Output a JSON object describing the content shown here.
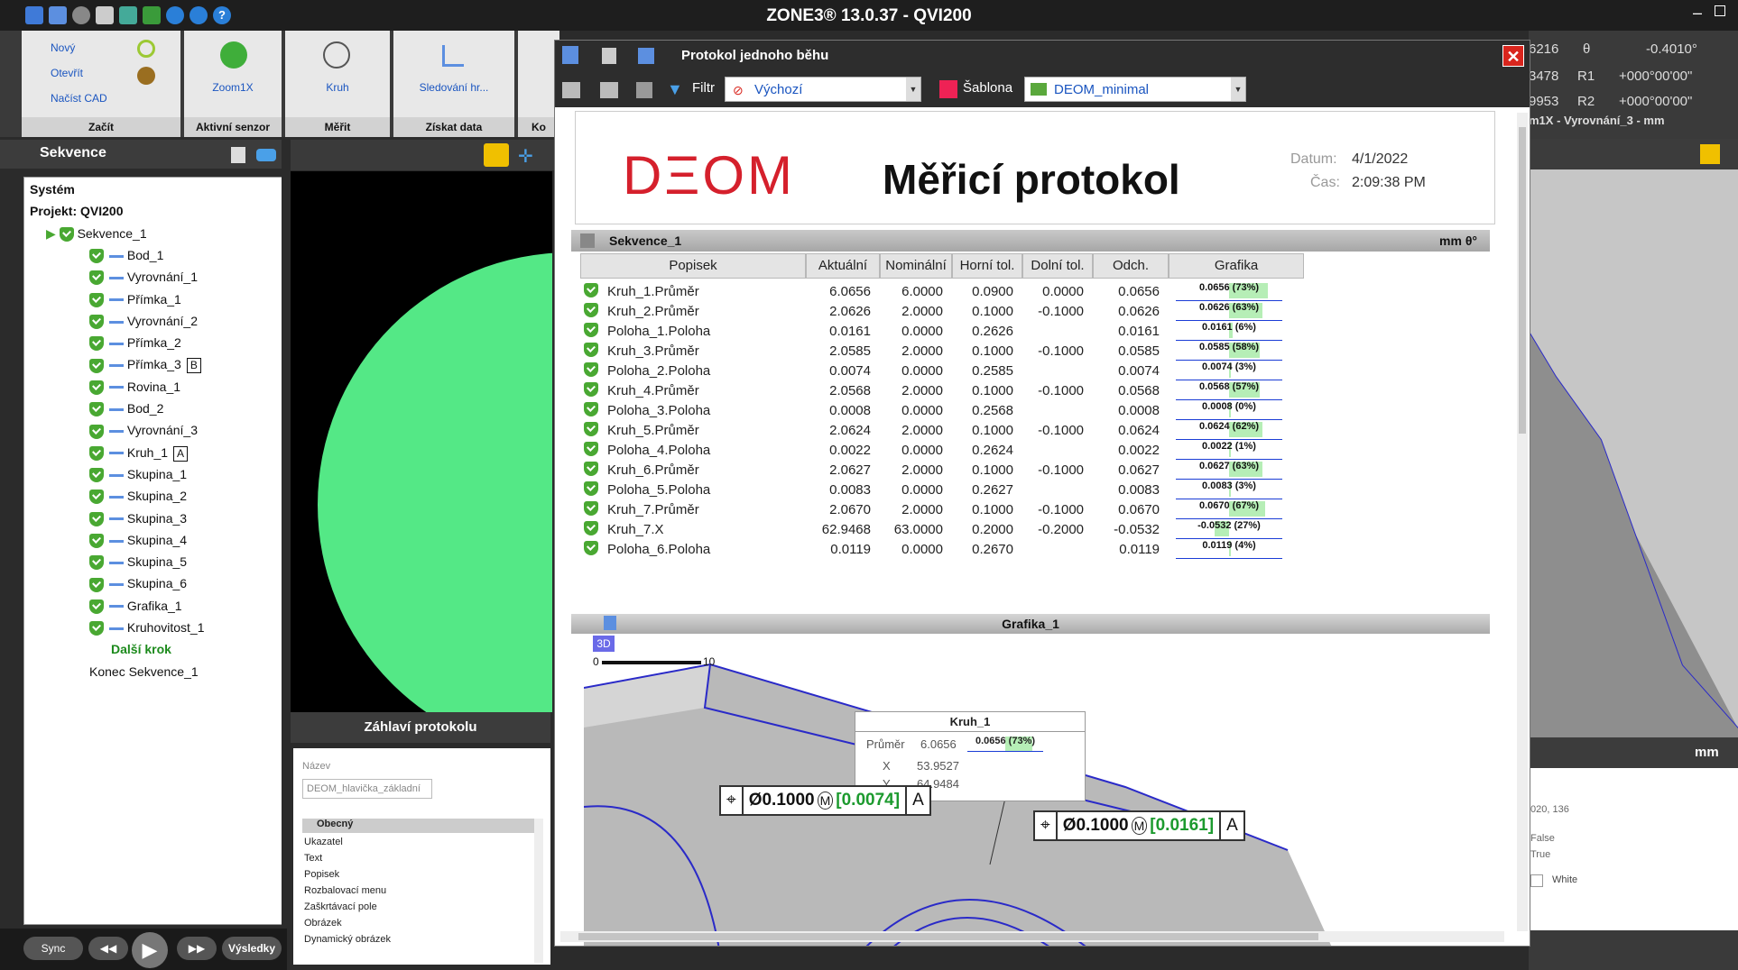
{
  "app": {
    "title": "ZONE3® 13.0.37 - QVI200"
  },
  "ribbon": {
    "file": {
      "new": "Nový",
      "open": "Otevřít",
      "load_cad": "Načíst CAD",
      "group": "Začít"
    },
    "sensor": {
      "label": "Zoom1X",
      "group": "Aktivní senzor"
    },
    "measure": {
      "label": "Kruh",
      "group": "Měřit"
    },
    "data": {
      "label": "Sledování hr...",
      "group": "Získat data"
    },
    "extra": {
      "group": "Ko"
    }
  },
  "sequence_panel": {
    "title": "Sekvence",
    "tree": [
      {
        "label": "Systém"
      },
      {
        "label": "Projekt: QVI200"
      },
      {
        "label": "Sekvence_1"
      },
      {
        "label": "Bod_1"
      },
      {
        "label": "Vyrovnání_1"
      },
      {
        "label": "Přímka_1"
      },
      {
        "label": "Vyrovnání_2"
      },
      {
        "label": "Přímka_2"
      },
      {
        "label": "Přímka_3",
        "badge": "B"
      },
      {
        "label": "Rovina_1"
      },
      {
        "label": "Bod_2"
      },
      {
        "label": "Vyrovnání_3"
      },
      {
        "label": "Kruh_1",
        "badge": "A"
      },
      {
        "label": "Skupina_1"
      },
      {
        "label": "Skupina_2"
      },
      {
        "label": "Skupina_3"
      },
      {
        "label": "Skupina_4"
      },
      {
        "label": "Skupina_5"
      },
      {
        "label": "Skupina_6"
      },
      {
        "label": "Grafika_1"
      },
      {
        "label": "Kruhovitost_1"
      },
      {
        "label": "Další krok"
      },
      {
        "label": "Konec Sekvence_1"
      }
    ]
  },
  "header_panel": {
    "title": "Záhlaví protokolu",
    "name_label": "Název",
    "name_value": "DEOM_hlavička_základní",
    "section": "Obecný",
    "items": [
      "Ukazatel",
      "Text",
      "Popisek",
      "Rozbalovací menu",
      "Zaškrtávací pole",
      "Obrázek",
      "Dynamický obrázek"
    ]
  },
  "playbar": {
    "sync": "Sync",
    "results": "Výsledky"
  },
  "protocol": {
    "window_title": "Protokol jednoho běhu",
    "filter_label": "Filtr",
    "filter_value": "Výchozí",
    "template_label": "Šablona",
    "template_value": "DEOM_minimal",
    "logo": "DΞOM",
    "report_title": "Měřicí protokol",
    "date_label": "Datum:",
    "date_value": "4/1/2022",
    "time_label": "Čas:",
    "time_value": "2:09:38 PM",
    "section_name": "Sekvence_1",
    "units": "mm  θ°",
    "columns": [
      "Popisek",
      "Aktuální",
      "Nominální",
      "Horní tol.",
      "Dolní tol.",
      "Odch.",
      "Grafika"
    ],
    "rows": [
      {
        "name": "Kruh_1.Průměr",
        "actual": "6.0656",
        "nominal": "6.0000",
        "upper": "0.0900",
        "lower": "0.0000",
        "dev": "0.0656",
        "graf": "0.0656 (73%)",
        "pct": 73
      },
      {
        "name": "Kruh_2.Průměr",
        "actual": "2.0626",
        "nominal": "2.0000",
        "upper": "0.1000",
        "lower": "-0.1000",
        "dev": "0.0626",
        "graf": "0.0626 (63%)",
        "pct": 63
      },
      {
        "name": "Poloha_1.Poloha",
        "actual": "0.0161",
        "nominal": "0.0000",
        "upper": "0.2626",
        "lower": "",
        "dev": "0.0161",
        "graf": "0.0161 (6%)",
        "pct": 6
      },
      {
        "name": "Kruh_3.Průměr",
        "actual": "2.0585",
        "nominal": "2.0000",
        "upper": "0.1000",
        "lower": "-0.1000",
        "dev": "0.0585",
        "graf": "0.0585 (58%)",
        "pct": 58
      },
      {
        "name": "Poloha_2.Poloha",
        "actual": "0.0074",
        "nominal": "0.0000",
        "upper": "0.2585",
        "lower": "",
        "dev": "0.0074",
        "graf": "0.0074 (3%)",
        "pct": 3
      },
      {
        "name": "Kruh_4.Průměr",
        "actual": "2.0568",
        "nominal": "2.0000",
        "upper": "0.1000",
        "lower": "-0.1000",
        "dev": "0.0568",
        "graf": "0.0568 (57%)",
        "pct": 57
      },
      {
        "name": "Poloha_3.Poloha",
        "actual": "0.0008",
        "nominal": "0.0000",
        "upper": "0.2568",
        "lower": "",
        "dev": "0.0008",
        "graf": "0.0008 (0%)",
        "pct": 0
      },
      {
        "name": "Kruh_5.Průměr",
        "actual": "2.0624",
        "nominal": "2.0000",
        "upper": "0.1000",
        "lower": "-0.1000",
        "dev": "0.0624",
        "graf": "0.0624 (62%)",
        "pct": 62
      },
      {
        "name": "Poloha_4.Poloha",
        "actual": "0.0022",
        "nominal": "0.0000",
        "upper": "0.2624",
        "lower": "",
        "dev": "0.0022",
        "graf": "0.0022 (1%)",
        "pct": 1
      },
      {
        "name": "Kruh_6.Průměr",
        "actual": "2.0627",
        "nominal": "2.0000",
        "upper": "0.1000",
        "lower": "-0.1000",
        "dev": "0.0627",
        "graf": "0.0627 (63%)",
        "pct": 63
      },
      {
        "name": "Poloha_5.Poloha",
        "actual": "0.0083",
        "nominal": "0.0000",
        "upper": "0.2627",
        "lower": "",
        "dev": "0.0083",
        "graf": "0.0083 (3%)",
        "pct": 3
      },
      {
        "name": "Kruh_7.Průměr",
        "actual": "2.0670",
        "nominal": "2.0000",
        "upper": "0.1000",
        "lower": "-0.1000",
        "dev": "0.0670",
        "graf": "0.0670 (67%)",
        "pct": 67
      },
      {
        "name": "Kruh_7.X",
        "actual": "62.9468",
        "nominal": "63.0000",
        "upper": "0.2000",
        "lower": "-0.2000",
        "dev": "-0.0532",
        "graf": "-0.0532 (27%)",
        "pct": 27
      },
      {
        "name": "Poloha_6.Poloha",
        "actual": "0.0119",
        "nominal": "0.0000",
        "upper": "0.2670",
        "lower": "",
        "dev": "0.0119",
        "graf": "0.0119 (4%)",
        "pct": 4
      }
    ],
    "graphic_name": "Grafika_1",
    "graphic_mode": "3D",
    "scale_label": "0",
    "scale_label_end": "10",
    "callout": {
      "title": "Kruh_1",
      "d_label": "Průměr",
      "d_value": "6.0656",
      "d_dev": "0.0656 (73%)",
      "x_label": "X",
      "x_value": "53.9527",
      "y_label": "Y",
      "y_value": "64.9484"
    },
    "fcf1": {
      "tol": "Ø0.1000",
      "mod": "M",
      "val": "[0.0074]",
      "datum": "A"
    },
    "fcf2": {
      "tol": "Ø0.1000",
      "mod": "M",
      "val": "[0.0161]",
      "datum": "A"
    }
  },
  "right_panel": {
    "r1": "6216",
    "r1b": "-0.4010°",
    "r2": "3478",
    "r2l": "R1",
    "r2v": "+000°00'00\"",
    "r3": "9953",
    "r3l": "R2",
    "r3v": "+000°00'00\"",
    "view_title": "m1X - Vyrovnání_3 - mm",
    "units": "mm",
    "coord": "020, 136",
    "false_val": "False",
    "true_val": "True",
    "white_val": "White"
  },
  "colors": {
    "accent": "#1a55c0",
    "ok_green": "#49a832",
    "logo_red": "#d5202c",
    "close": "#d9251d"
  }
}
